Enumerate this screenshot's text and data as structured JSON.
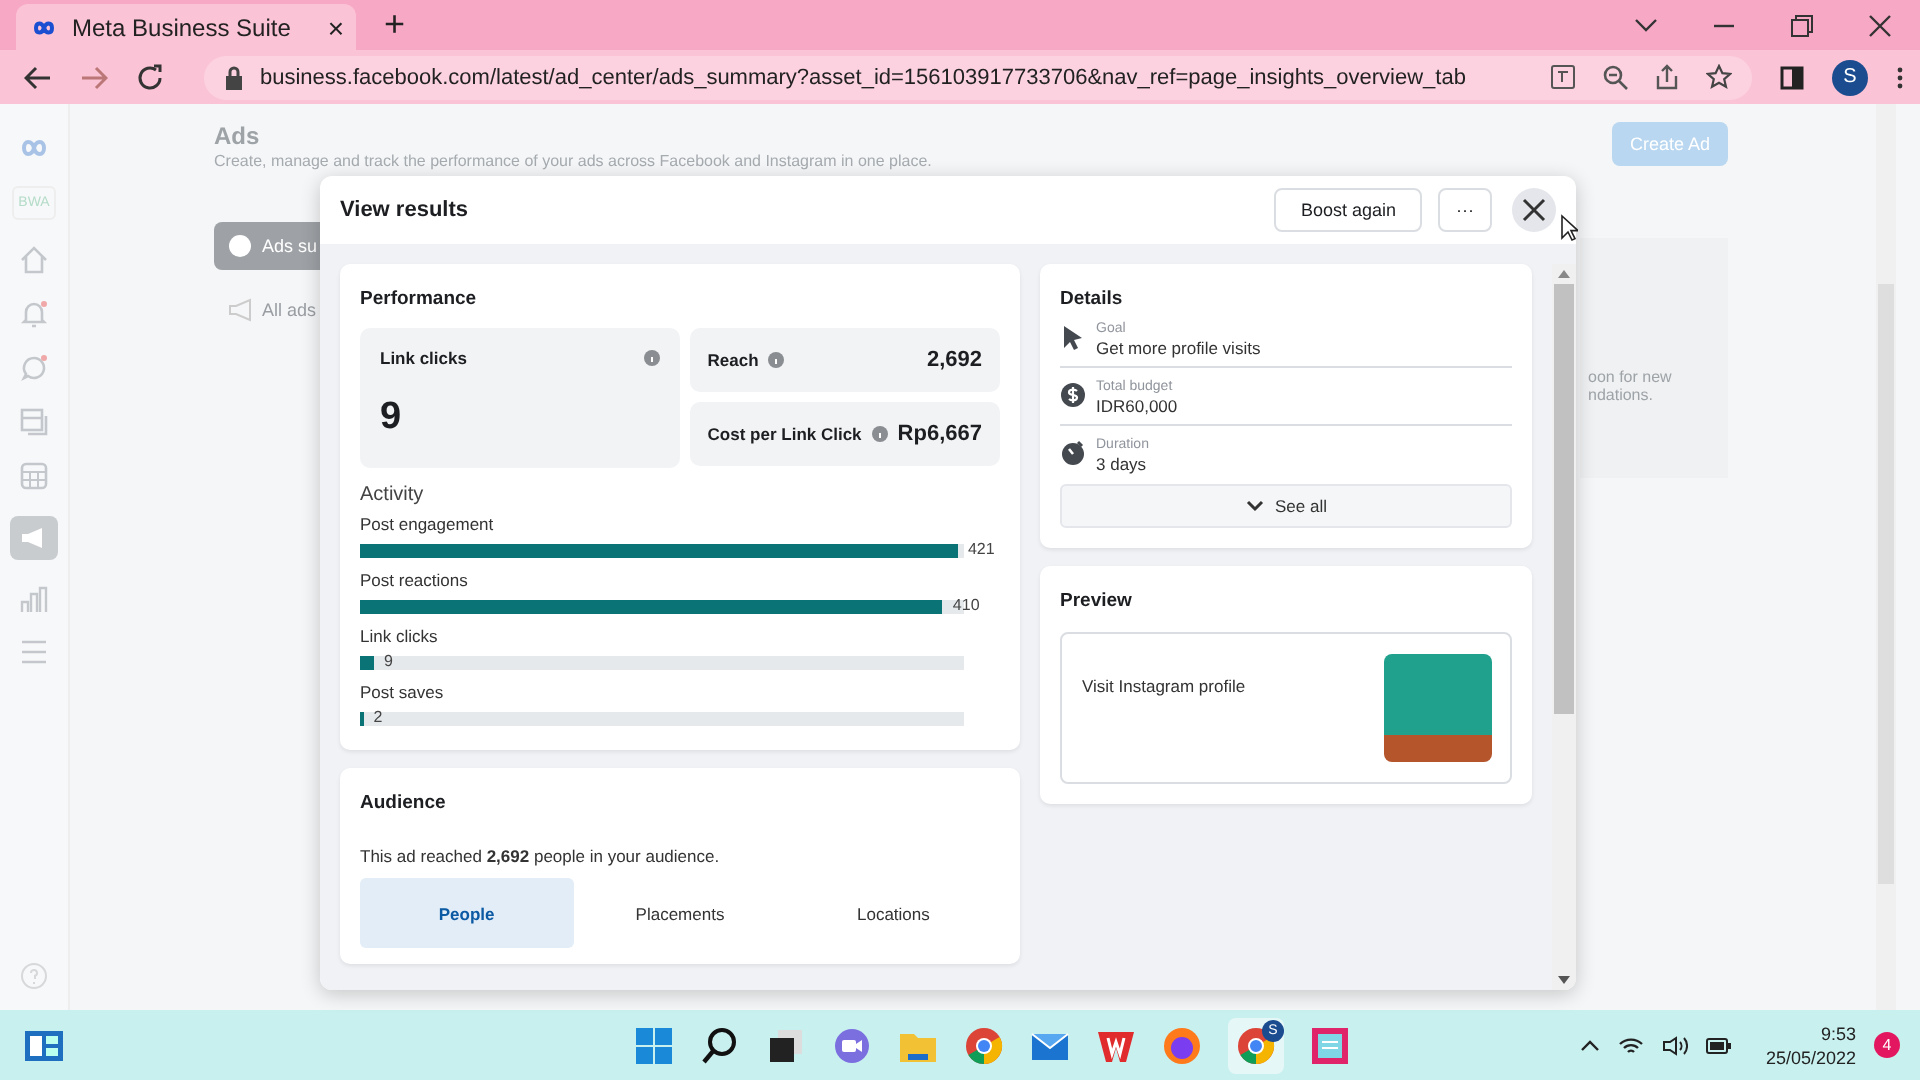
{
  "browser": {
    "tab_title": "Meta Business Suite",
    "close_tab": "×",
    "new_tab": "+",
    "url": "business.facebook.com/latest/ad_center/ads_summary?asset_id=156103917733706&nav_ref=page_insights_overview_tab",
    "profile": "S"
  },
  "page": {
    "rail_badge": "BWA",
    "title": "Ads",
    "subtitle": "Create, manage and track the performance of your ads across Facebook and Instagram in one place.",
    "create_button": "Create Ad",
    "nav_items": [
      {
        "label": "Ads su",
        "selected": true
      },
      {
        "label": "All ads",
        "selected": false
      }
    ],
    "hint_lines": [
      "oon for new",
      "ndations."
    ]
  },
  "modal": {
    "title": "View results",
    "boost_button": "Boost again",
    "more_button": "···",
    "performance": {
      "title": "Performance",
      "metrics": [
        {
          "kind": "tall",
          "label": "Link clicks",
          "value": "9"
        },
        {
          "kind": "row",
          "label": "Reach",
          "value": "2,692"
        },
        {
          "kind": "row",
          "label": "Cost per Link Click",
          "value": "Rp6,667"
        }
      ]
    },
    "activity": {
      "title": "Activity",
      "items": [
        {
          "label": "Post engagement",
          "value": "421",
          "level": 0.99
        },
        {
          "label": "Post reactions",
          "value": "410",
          "level": 0.965
        },
        {
          "label": "Link clicks",
          "value": "9",
          "level": 0.023
        },
        {
          "label": "Post saves",
          "value": "2",
          "level": 0.006
        }
      ]
    },
    "audience": {
      "title": "Audience",
      "summary": "This ad reached **2,692** people in your audience.",
      "tabs": [
        {
          "label": "People",
          "selected": true
        },
        {
          "label": "Placements",
          "selected": false
        },
        {
          "label": "Locations",
          "selected": false
        }
      ]
    },
    "details": {
      "title": "Details",
      "items": [
        {
          "kind": "goal",
          "label": "Goal",
          "value": "Get more profile visits"
        },
        {
          "kind": "budget",
          "label": "Total budget",
          "value": "IDR60,000"
        },
        {
          "kind": "duration",
          "label": "Duration",
          "value": "3 days"
        }
      ],
      "see_all": "See all"
    },
    "preview": {
      "title": "Preview",
      "label": "Visit Instagram profile"
    }
  },
  "taskbar": {
    "chrome_badge": "S",
    "time": "9:53",
    "date": "25/05/2022",
    "notifications": "4"
  }
}
